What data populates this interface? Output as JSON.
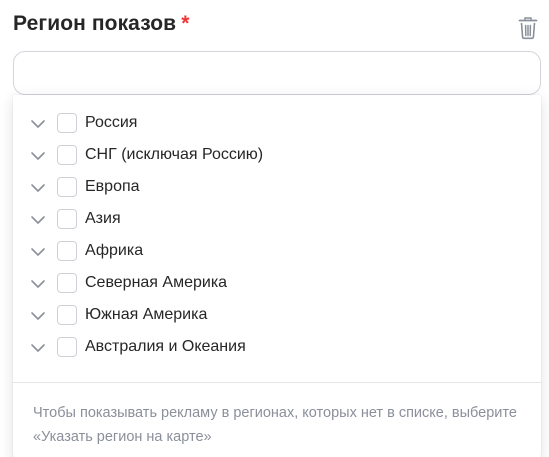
{
  "field": {
    "title": "Регион показов",
    "required_mark": "*"
  },
  "icons": {
    "trash": "trash-icon",
    "chevron": "chevron-down-icon"
  },
  "search": {
    "value": "",
    "placeholder": ""
  },
  "regions": [
    {
      "label": "Россия",
      "checked": false
    },
    {
      "label": "СНГ (исключая Россию)",
      "checked": false
    },
    {
      "label": "Европа",
      "checked": false
    },
    {
      "label": "Азия",
      "checked": false
    },
    {
      "label": "Африка",
      "checked": false
    },
    {
      "label": "Северная Америка",
      "checked": false
    },
    {
      "label": "Южная Америка",
      "checked": false
    },
    {
      "label": "Австралия и Океания",
      "checked": false
    }
  ],
  "hint": "Чтобы показывать рекламу в регионах, которых нет в списке, выберите «Указать регион на карте»",
  "colors": {
    "required": "#f03434",
    "text": "#262626",
    "hint_text": "#8a8f9a",
    "border": "#d3d5db",
    "icon": "#8b8f99"
  }
}
